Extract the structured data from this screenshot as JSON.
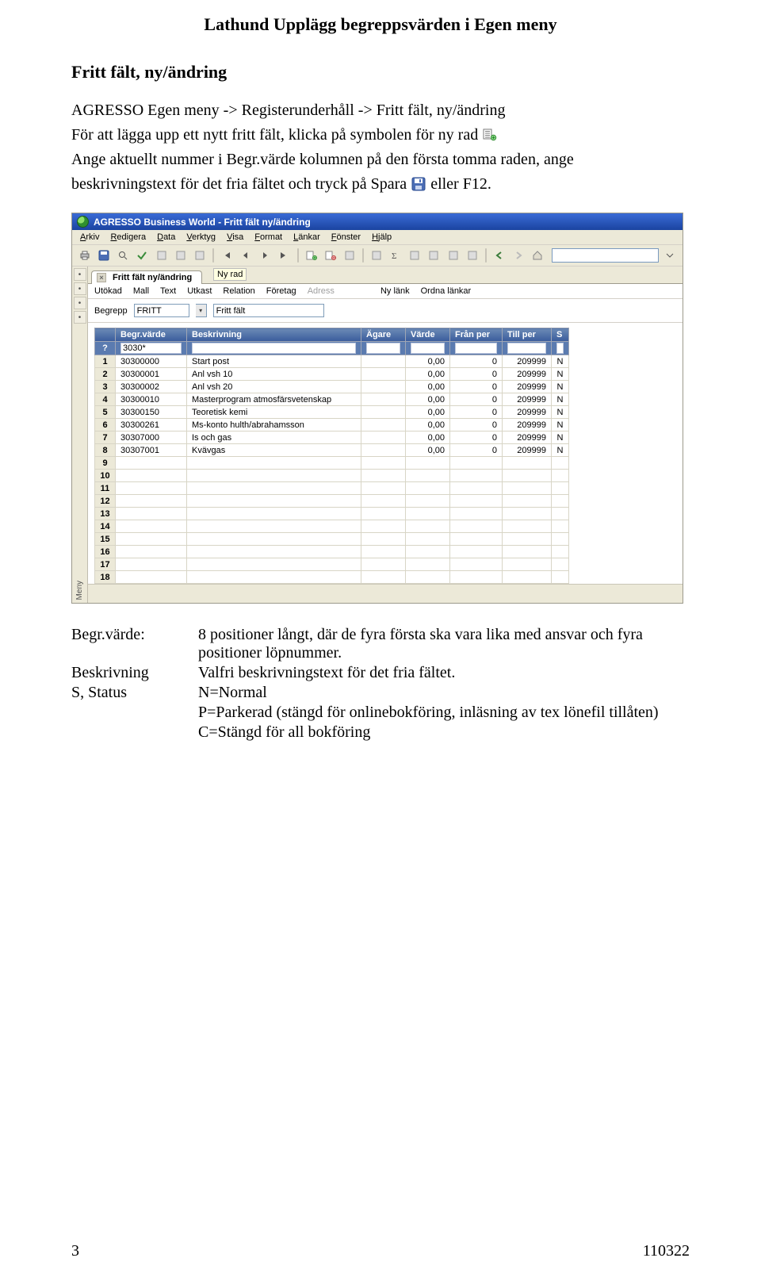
{
  "doc": {
    "title": "Lathund Upplägg begreppsvärden i Egen meny",
    "section_head": "Fritt fält, ny/ändring",
    "line1": "AGRESSO Egen meny -> Registerunderhåll -> Fritt fält, ny/ändring",
    "line2a": "För att lägga upp ett nytt fritt fält, klicka på symbolen för ny rad",
    "line3a": "Ange aktuellt nummer i Begr.värde kolumnen på den första tomma raden, ange",
    "line4a": "beskrivningstext för det fria fältet och tryck på Spara",
    "line4b": "eller F12.",
    "definitions": [
      {
        "term": "Begr.värde:",
        "desc": "8 positioner långt, där de fyra första ska vara lika med ansvar och fyra positioner löpnummer."
      },
      {
        "term": "Beskrivning",
        "desc": "Valfri beskrivningstext för det fria fältet."
      },
      {
        "term": "S, Status",
        "desc": "N=Normal"
      },
      {
        "term": "",
        "desc": "P=Parkerad (stängd för onlinebokföring, inläsning av tex lönefil tillåten)"
      },
      {
        "term": "",
        "desc": "C=Stängd för all bokföring"
      }
    ],
    "page_no": "3",
    "footer_right": "110322"
  },
  "shot": {
    "window_title": "AGRESSO Business World  -  Fritt fält ny/ändring",
    "menu": [
      "Arkiv",
      "Redigera",
      "Data",
      "Verktyg",
      "Visa",
      "Format",
      "Länkar",
      "Fönster",
      "Hjälp"
    ],
    "tab_label": "Fritt fält ny/ändring",
    "tooltip": "Ny rad",
    "linkbar": [
      {
        "label": "Utökad",
        "disabled": false
      },
      {
        "label": "Mall",
        "disabled": false
      },
      {
        "label": "Text",
        "disabled": false
      },
      {
        "label": "Utkast",
        "disabled": false
      },
      {
        "label": "Relation",
        "disabled": false
      },
      {
        "label": "Företag",
        "disabled": false
      },
      {
        "label": "Adress",
        "disabled": true
      },
      {
        "label": "Ny länk",
        "disabled": false
      },
      {
        "label": "Ordna länkar",
        "disabled": false
      }
    ],
    "form": {
      "label1": "Begrepp",
      "value1": "FRITT",
      "value2": "Fritt fält"
    },
    "columns": [
      "Begr.värde",
      "Beskrivning",
      "Ägare",
      "Värde",
      "Från per",
      "Till per",
      "S"
    ],
    "filter_value": "3030*",
    "rows": [
      {
        "n": "1",
        "v": "30300000",
        "b": "Start post",
        "ag": "",
        "va": "0,00",
        "fp": "0",
        "tp": "209999",
        "s": "N"
      },
      {
        "n": "2",
        "v": "30300001",
        "b": "Anl vsh 10",
        "ag": "",
        "va": "0,00",
        "fp": "0",
        "tp": "209999",
        "s": "N"
      },
      {
        "n": "3",
        "v": "30300002",
        "b": "Anl vsh 20",
        "ag": "",
        "va": "0,00",
        "fp": "0",
        "tp": "209999",
        "s": "N"
      },
      {
        "n": "4",
        "v": "30300010",
        "b": "Masterprogram atmosfärsvetenskap",
        "ag": "",
        "va": "0,00",
        "fp": "0",
        "tp": "209999",
        "s": "N"
      },
      {
        "n": "5",
        "v": "30300150",
        "b": "Teoretisk kemi",
        "ag": "",
        "va": "0,00",
        "fp": "0",
        "tp": "209999",
        "s": "N"
      },
      {
        "n": "6",
        "v": "30300261",
        "b": "Ms-konto hulth/abrahamsson",
        "ag": "",
        "va": "0,00",
        "fp": "0",
        "tp": "209999",
        "s": "N"
      },
      {
        "n": "7",
        "v": "30307000",
        "b": "Is och gas",
        "ag": "",
        "va": "0,00",
        "fp": "0",
        "tp": "209999",
        "s": "N"
      },
      {
        "n": "8",
        "v": "30307001",
        "b": "Kvävgas",
        "ag": "",
        "va": "0,00",
        "fp": "0",
        "tp": "209999",
        "s": "N"
      },
      {
        "n": "9",
        "v": "",
        "b": "",
        "ag": "",
        "va": "",
        "fp": "",
        "tp": "",
        "s": ""
      },
      {
        "n": "10",
        "v": "",
        "b": "",
        "ag": "",
        "va": "",
        "fp": "",
        "tp": "",
        "s": ""
      },
      {
        "n": "11",
        "v": "",
        "b": "",
        "ag": "",
        "va": "",
        "fp": "",
        "tp": "",
        "s": ""
      },
      {
        "n": "12",
        "v": "",
        "b": "",
        "ag": "",
        "va": "",
        "fp": "",
        "tp": "",
        "s": ""
      },
      {
        "n": "13",
        "v": "",
        "b": "",
        "ag": "",
        "va": "",
        "fp": "",
        "tp": "",
        "s": ""
      },
      {
        "n": "14",
        "v": "",
        "b": "",
        "ag": "",
        "va": "",
        "fp": "",
        "tp": "",
        "s": ""
      },
      {
        "n": "15",
        "v": "",
        "b": "",
        "ag": "",
        "va": "",
        "fp": "",
        "tp": "",
        "s": ""
      },
      {
        "n": "16",
        "v": "",
        "b": "",
        "ag": "",
        "va": "",
        "fp": "",
        "tp": "",
        "s": ""
      },
      {
        "n": "17",
        "v": "",
        "b": "",
        "ag": "",
        "va": "",
        "fp": "",
        "tp": "",
        "s": ""
      },
      {
        "n": "18",
        "v": "",
        "b": "",
        "ag": "",
        "va": "",
        "fp": "",
        "tp": "",
        "s": ""
      }
    ],
    "toolbar_icons": [
      "print-icon",
      "save-icon",
      "search-icon",
      "checkmark-icon",
      "key-icon",
      "wizard-icon",
      "tree-icon",
      "sep",
      "first-icon",
      "prev-icon",
      "next-icon",
      "last-icon",
      "sep",
      "new-row-icon",
      "delete-row-icon",
      "copy-icon",
      "sep",
      "chart-icon",
      "sum-icon",
      "find-icon",
      "zoom-icon",
      "printpreview-icon",
      "gear-icon",
      "sep",
      "back-icon",
      "forward-icon",
      "home-icon"
    ],
    "left_rail": [
      "window-icon",
      "pin-icon",
      "expand-icon",
      "help-icon"
    ],
    "side_label": "Meny"
  }
}
